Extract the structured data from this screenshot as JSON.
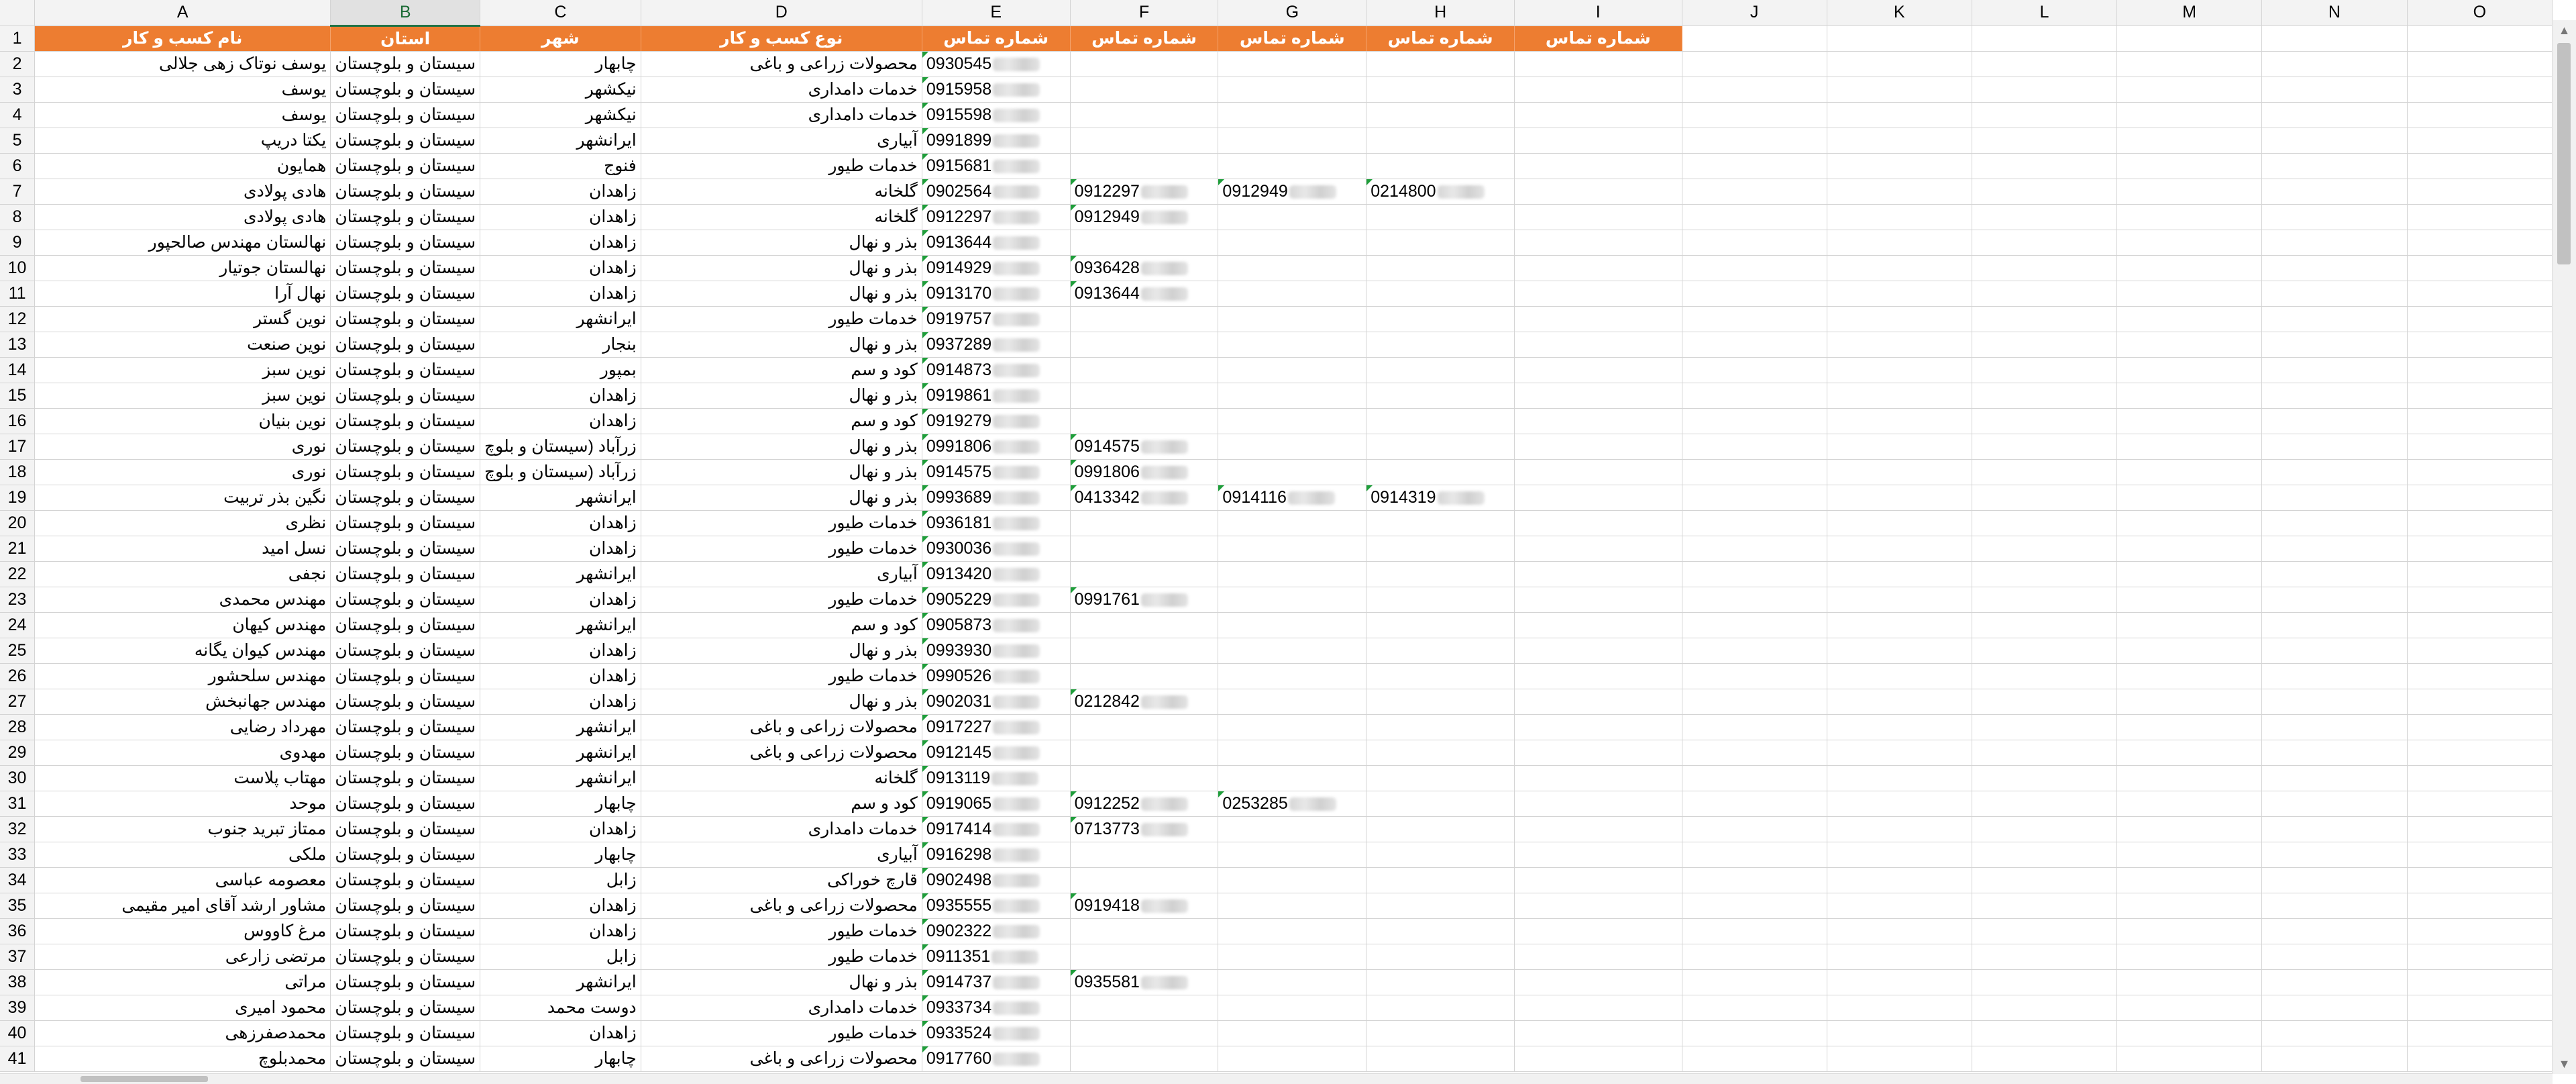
{
  "columns": [
    "A",
    "B",
    "C",
    "D",
    "E",
    "F",
    "G",
    "H",
    "I",
    "J",
    "K",
    "L",
    "M",
    "N",
    "O"
  ],
  "selected_column": "B",
  "header_labels": [
    "نام کسب و کار",
    "استان",
    "شهر",
    "نوع کسب و کار",
    "شماره تماس",
    "شماره تماس",
    "شماره تماس",
    "شماره تماس",
    "شماره تماس"
  ],
  "rows": [
    {
      "n": "2",
      "a": "یوسف نوتاک زهی جلالی",
      "b": "سیستان و بلوچستان",
      "c": "چابهار",
      "d": "محصولات زراعی و باغی",
      "e": "0930545",
      "f": "",
      "g": "",
      "h": ""
    },
    {
      "n": "3",
      "a": "یوسف",
      "b": "سیستان و بلوچستان",
      "c": "نیکشهر",
      "d": "خدمات دامداری",
      "e": "0915958",
      "f": "",
      "g": "",
      "h": ""
    },
    {
      "n": "4",
      "a": "یوسف",
      "b": "سیستان و بلوچستان",
      "c": "نیکشهر",
      "d": "خدمات دامداری",
      "e": "0915598",
      "f": "",
      "g": "",
      "h": ""
    },
    {
      "n": "5",
      "a": "یکتا دریپ",
      "b": "سیستان و بلوچستان",
      "c": "ایرانشهر",
      "d": "آبیاری",
      "e": "0991899",
      "f": "",
      "g": "",
      "h": ""
    },
    {
      "n": "6",
      "a": "همایون",
      "b": "سیستان و بلوچستان",
      "c": "فنوج",
      "d": "خدمات طیور",
      "e": "0915681",
      "f": "",
      "g": "",
      "h": ""
    },
    {
      "n": "7",
      "a": "هادی پولادی",
      "b": "سیستان و بلوچستان",
      "c": "زاهدان",
      "d": "گلخانه",
      "e": "0902564",
      "f": "0912297",
      "g": "0912949",
      "h": "0214800"
    },
    {
      "n": "8",
      "a": "هادی پولادی",
      "b": "سیستان و بلوچستان",
      "c": "زاهدان",
      "d": "گلخانه",
      "e": "0912297",
      "f": "0912949",
      "g": "",
      "h": ""
    },
    {
      "n": "9",
      "a": "نهالستان مهندس صالحپور",
      "b": "سیستان و بلوچستان",
      "c": "زاهدان",
      "d": "بذر و نهال",
      "e": "0913644",
      "f": "",
      "g": "",
      "h": ""
    },
    {
      "n": "10",
      "a": "نهالستان جوتیار",
      "b": "سیستان و بلوچستان",
      "c": "زاهدان",
      "d": "بذر و نهال",
      "e": "0914929",
      "f": "0936428",
      "g": "",
      "h": ""
    },
    {
      "n": "11",
      "a": "نهال آرا",
      "b": "سیستان و بلوچستان",
      "c": "زاهدان",
      "d": "بذر و نهال",
      "e": "0913170",
      "f": "0913644",
      "g": "",
      "h": ""
    },
    {
      "n": "12",
      "a": "نوین گستر",
      "b": "سیستان و بلوچستان",
      "c": "ایرانشهر",
      "d": "خدمات طیور",
      "e": "0919757",
      "f": "",
      "g": "",
      "h": ""
    },
    {
      "n": "13",
      "a": "نوین صنعت",
      "b": "سیستان و بلوچستان",
      "c": "بنجار",
      "d": "بذر و نهال",
      "e": "0937289",
      "f": "",
      "g": "",
      "h": ""
    },
    {
      "n": "14",
      "a": "نوین سبز",
      "b": "سیستان و بلوچستان",
      "c": "بمپور",
      "d": "کود و سم",
      "e": "0914873",
      "f": "",
      "g": "",
      "h": ""
    },
    {
      "n": "15",
      "a": "نوین سبز",
      "b": "سیستان و بلوچستان",
      "c": "زاهدان",
      "d": "بذر و نهال",
      "e": "0919861",
      "f": "",
      "g": "",
      "h": ""
    },
    {
      "n": "16",
      "a": "نوین بنیان",
      "b": "سیستان و بلوچستان",
      "c": "زاهدان",
      "d": "کود و سم",
      "e": "0919279",
      "f": "",
      "g": "",
      "h": ""
    },
    {
      "n": "17",
      "a": "نوری",
      "b": "سیستان و بلوچستان",
      "c": "زرآباد (سیستان و بلوچ",
      "d": "بذر و نهال",
      "e": "0991806",
      "f": "0914575",
      "g": "",
      "h": ""
    },
    {
      "n": "18",
      "a": "نوری",
      "b": "سیستان و بلوچستان",
      "c": "زرآباد (سیستان و بلوچ",
      "d": "بذر و نهال",
      "e": "0914575",
      "f": "0991806",
      "g": "",
      "h": ""
    },
    {
      "n": "19",
      "a": "نگین بذر تربیت",
      "b": "سیستان و بلوچستان",
      "c": "ایرانشهر",
      "d": "بذر و نهال",
      "e": "0993689",
      "f": "0413342",
      "g": "0914116",
      "h": "0914319"
    },
    {
      "n": "20",
      "a": "نظری",
      "b": "سیستان و بلوچستان",
      "c": "زاهدان",
      "d": "خدمات طیور",
      "e": "0936181",
      "f": "",
      "g": "",
      "h": ""
    },
    {
      "n": "21",
      "a": "نسل امید",
      "b": "سیستان و بلوچستان",
      "c": "زاهدان",
      "d": "خدمات طیور",
      "e": "0930036",
      "f": "",
      "g": "",
      "h": ""
    },
    {
      "n": "22",
      "a": "نجفی",
      "b": "سیستان و بلوچستان",
      "c": "ایرانشهر",
      "d": "آبیاری",
      "e": "0913420",
      "f": "",
      "g": "",
      "h": ""
    },
    {
      "n": "23",
      "a": "مهندس محمدی",
      "b": "سیستان و بلوچستان",
      "c": "زاهدان",
      "d": "خدمات طیور",
      "e": "0905229",
      "f": "0991761",
      "g": "",
      "h": ""
    },
    {
      "n": "24",
      "a": "مهندس کیهان",
      "b": "سیستان و بلوچستان",
      "c": "ایرانشهر",
      "d": "کود و سم",
      "e": "0905873",
      "f": "",
      "g": "",
      "h": ""
    },
    {
      "n": "25",
      "a": "مهندس کیوان یگانه",
      "b": "سیستان و بلوچستان",
      "c": "زاهدان",
      "d": "بذر و نهال",
      "e": "0993930",
      "f": "",
      "g": "",
      "h": ""
    },
    {
      "n": "26",
      "a": "مهندس سلحشور",
      "b": "سیستان و بلوچستان",
      "c": "زاهدان",
      "d": "خدمات طیور",
      "e": "0990526",
      "f": "",
      "g": "",
      "h": ""
    },
    {
      "n": "27",
      "a": "مهندس جهانبخش",
      "b": "سیستان و بلوچستان",
      "c": "زاهدان",
      "d": "بذر و نهال",
      "e": "0902031",
      "f": "0212842",
      "g": "",
      "h": ""
    },
    {
      "n": "28",
      "a": "مهرداد رضایی",
      "b": "سیستان و بلوچستان",
      "c": "ایرانشهر",
      "d": "محصولات زراعی و باغی",
      "e": "0917227",
      "f": "",
      "g": "",
      "h": ""
    },
    {
      "n": "29",
      "a": "مهدوی",
      "b": "سیستان و بلوچستان",
      "c": "ایرانشهر",
      "d": "محصولات زراعی و باغی",
      "e": "0912145",
      "f": "",
      "g": "",
      "h": ""
    },
    {
      "n": "30",
      "a": "مهتاب پلاست",
      "b": "سیستان و بلوچستان",
      "c": "ایرانشهر",
      "d": "گلخانه",
      "e": "0913119",
      "f": "",
      "g": "",
      "h": ""
    },
    {
      "n": "31",
      "a": "موحد",
      "b": "سیستان و بلوچستان",
      "c": "چابهار",
      "d": "کود و سم",
      "e": "0919065",
      "f": "0912252",
      "g": "0253285",
      "h": ""
    },
    {
      "n": "32",
      "a": "ممتاز تبرید جنوب",
      "b": "سیستان و بلوچستان",
      "c": "زاهدان",
      "d": "خدمات دامداری",
      "e": "0917414",
      "f": "0713773",
      "g": "",
      "h": ""
    },
    {
      "n": "33",
      "a": "ملکی",
      "b": "سیستان و بلوچستان",
      "c": "چابهار",
      "d": "آبیاری",
      "e": "0916298",
      "f": "",
      "g": "",
      "h": ""
    },
    {
      "n": "34",
      "a": "معصومه عباسی",
      "b": "سیستان و بلوچستان",
      "c": "زابل",
      "d": "قارچ خوراکی",
      "e": "0902498",
      "f": "",
      "g": "",
      "h": ""
    },
    {
      "n": "35",
      "a": "مشاور ارشد آقای امیر مقیمی",
      "b": "سیستان و بلوچستان",
      "c": "زاهدان",
      "d": "محصولات زراعی و باغی",
      "e": "0935555",
      "f": "0919418",
      "g": "",
      "h": ""
    },
    {
      "n": "36",
      "a": "مرغ کاووس",
      "b": "سیستان و بلوچستان",
      "c": "زاهدان",
      "d": "خدمات طیور",
      "e": "0902322",
      "f": "",
      "g": "",
      "h": ""
    },
    {
      "n": "37",
      "a": "مرتضی زارعی",
      "b": "سیستان و بلوچستان",
      "c": "زابل",
      "d": "خدمات طیور",
      "e": "0911351",
      "f": "",
      "g": "",
      "h": ""
    },
    {
      "n": "38",
      "a": "مراتی",
      "b": "سیستان و بلوچستان",
      "c": "ایرانشهر",
      "d": "بذر و نهال",
      "e": "0914737",
      "f": "0935581",
      "g": "",
      "h": ""
    },
    {
      "n": "39",
      "a": "محمود امیری",
      "b": "سیستان و بلوچستان",
      "c": "دوست محمد",
      "d": "خدمات دامداری",
      "e": "0933734",
      "f": "",
      "g": "",
      "h": ""
    },
    {
      "n": "40",
      "a": "محمدصفرزهی",
      "b": "سیستان و بلوچستان",
      "c": "زاهدان",
      "d": "خدمات طیور",
      "e": "0933524",
      "f": "",
      "g": "",
      "h": ""
    },
    {
      "n": "41",
      "a": "محمدبلوچ",
      "b": "سیستان و بلوچستان",
      "c": "چابهار",
      "d": "محصولات زراعی و باغی",
      "e": "0917760",
      "f": "",
      "g": "",
      "h": ""
    }
  ]
}
